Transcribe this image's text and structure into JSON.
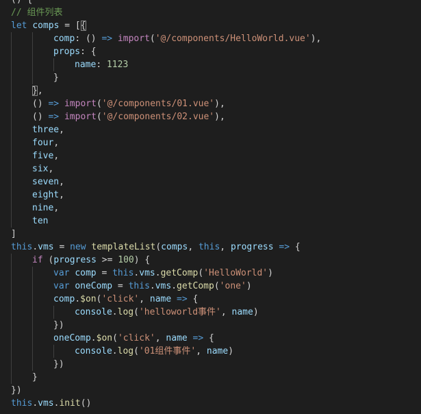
{
  "editor": {
    "lines": [
      {
        "indent": 0,
        "tokens": [
          {
            "t": "() {",
            "c": "punct"
          }
        ]
      },
      {
        "indent": 0,
        "tokens": [
          {
            "t": "// 组件列表",
            "c": "comment"
          }
        ]
      },
      {
        "indent": 0,
        "tokens": [
          {
            "t": "let",
            "c": "keyword"
          },
          {
            "t": " ",
            "c": "punct"
          },
          {
            "t": "comps",
            "c": "var"
          },
          {
            "t": " = [",
            "c": "punct"
          },
          {
            "t": "{",
            "c": "bmatch"
          }
        ]
      },
      {
        "indent": 2,
        "tokens": [
          {
            "t": "comp",
            "c": "var"
          },
          {
            "t": ": () ",
            "c": "punct"
          },
          {
            "t": "=>",
            "c": "keyword"
          },
          {
            "t": " ",
            "c": "punct"
          },
          {
            "t": "import",
            "c": "ctrl"
          },
          {
            "t": "(",
            "c": "punct"
          },
          {
            "t": "'@/components/HelloWorld.vue'",
            "c": "str"
          },
          {
            "t": "),",
            "c": "punct"
          }
        ]
      },
      {
        "indent": 2,
        "tokens": [
          {
            "t": "props",
            "c": "var"
          },
          {
            "t": ": {",
            "c": "punct"
          }
        ]
      },
      {
        "indent": 3,
        "tokens": [
          {
            "t": "name",
            "c": "var"
          },
          {
            "t": ": ",
            "c": "punct"
          },
          {
            "t": "1123",
            "c": "num"
          }
        ]
      },
      {
        "indent": 2,
        "tokens": [
          {
            "t": "}",
            "c": "punct"
          }
        ]
      },
      {
        "indent": 1,
        "tokens": [
          {
            "t": "}",
            "c": "bmatch"
          },
          {
            "t": ",",
            "c": "punct"
          }
        ]
      },
      {
        "indent": 1,
        "tokens": [
          {
            "t": "() ",
            "c": "punct"
          },
          {
            "t": "=>",
            "c": "keyword"
          },
          {
            "t": " ",
            "c": "punct"
          },
          {
            "t": "import",
            "c": "ctrl"
          },
          {
            "t": "(",
            "c": "punct"
          },
          {
            "t": "'@/components/01.vue'",
            "c": "str"
          },
          {
            "t": "),",
            "c": "punct"
          }
        ]
      },
      {
        "indent": 1,
        "tokens": [
          {
            "t": "() ",
            "c": "punct"
          },
          {
            "t": "=>",
            "c": "keyword"
          },
          {
            "t": " ",
            "c": "punct"
          },
          {
            "t": "import",
            "c": "ctrl"
          },
          {
            "t": "(",
            "c": "punct"
          },
          {
            "t": "'@/components/02.vue'",
            "c": "str"
          },
          {
            "t": "),",
            "c": "punct"
          }
        ]
      },
      {
        "indent": 1,
        "tokens": [
          {
            "t": "three",
            "c": "var"
          },
          {
            "t": ",",
            "c": "punct"
          }
        ]
      },
      {
        "indent": 1,
        "tokens": [
          {
            "t": "four",
            "c": "var"
          },
          {
            "t": ",",
            "c": "punct"
          }
        ]
      },
      {
        "indent": 1,
        "tokens": [
          {
            "t": "five",
            "c": "var"
          },
          {
            "t": ",",
            "c": "punct"
          }
        ]
      },
      {
        "indent": 1,
        "tokens": [
          {
            "t": "six",
            "c": "var"
          },
          {
            "t": ",",
            "c": "punct"
          }
        ]
      },
      {
        "indent": 1,
        "tokens": [
          {
            "t": "seven",
            "c": "var"
          },
          {
            "t": ",",
            "c": "punct"
          }
        ]
      },
      {
        "indent": 1,
        "tokens": [
          {
            "t": "eight",
            "c": "var"
          },
          {
            "t": ",",
            "c": "punct"
          }
        ]
      },
      {
        "indent": 1,
        "tokens": [
          {
            "t": "nine",
            "c": "var"
          },
          {
            "t": ",",
            "c": "punct"
          }
        ]
      },
      {
        "indent": 1,
        "tokens": [
          {
            "t": "ten",
            "c": "var"
          }
        ]
      },
      {
        "indent": 0,
        "tokens": [
          {
            "t": "]",
            "c": "punct"
          }
        ]
      },
      {
        "indent": 0,
        "tokens": [
          {
            "t": "this",
            "c": "keyword"
          },
          {
            "t": ".",
            "c": "punct"
          },
          {
            "t": "vms",
            "c": "var"
          },
          {
            "t": " = ",
            "c": "punct"
          },
          {
            "t": "new",
            "c": "keyword"
          },
          {
            "t": " ",
            "c": "punct"
          },
          {
            "t": "templateList",
            "c": "fn"
          },
          {
            "t": "(",
            "c": "punct"
          },
          {
            "t": "comps",
            "c": "var"
          },
          {
            "t": ", ",
            "c": "punct"
          },
          {
            "t": "this",
            "c": "keyword"
          },
          {
            "t": ", ",
            "c": "punct"
          },
          {
            "t": "progress",
            "c": "var"
          },
          {
            "t": " ",
            "c": "punct"
          },
          {
            "t": "=>",
            "c": "keyword"
          },
          {
            "t": " {",
            "c": "punct"
          }
        ]
      },
      {
        "indent": 1,
        "tokens": [
          {
            "t": "if",
            "c": "ctrl"
          },
          {
            "t": " (",
            "c": "punct"
          },
          {
            "t": "progress",
            "c": "var"
          },
          {
            "t": " >= ",
            "c": "punct"
          },
          {
            "t": "100",
            "c": "num"
          },
          {
            "t": ") {",
            "c": "punct"
          }
        ]
      },
      {
        "indent": 2,
        "tokens": [
          {
            "t": "var",
            "c": "keyword"
          },
          {
            "t": " ",
            "c": "punct"
          },
          {
            "t": "comp",
            "c": "var"
          },
          {
            "t": " = ",
            "c": "punct"
          },
          {
            "t": "this",
            "c": "keyword"
          },
          {
            "t": ".",
            "c": "punct"
          },
          {
            "t": "vms",
            "c": "var"
          },
          {
            "t": ".",
            "c": "punct"
          },
          {
            "t": "getComp",
            "c": "fn"
          },
          {
            "t": "(",
            "c": "punct"
          },
          {
            "t": "'HelloWorld'",
            "c": "str"
          },
          {
            "t": ")",
            "c": "punct"
          }
        ]
      },
      {
        "indent": 2,
        "tokens": [
          {
            "t": "var",
            "c": "keyword"
          },
          {
            "t": " ",
            "c": "punct"
          },
          {
            "t": "oneComp",
            "c": "var"
          },
          {
            "t": " = ",
            "c": "punct"
          },
          {
            "t": "this",
            "c": "keyword"
          },
          {
            "t": ".",
            "c": "punct"
          },
          {
            "t": "vms",
            "c": "var"
          },
          {
            "t": ".",
            "c": "punct"
          },
          {
            "t": "getComp",
            "c": "fn"
          },
          {
            "t": "(",
            "c": "punct"
          },
          {
            "t": "'one'",
            "c": "str"
          },
          {
            "t": ")",
            "c": "punct"
          }
        ]
      },
      {
        "indent": 2,
        "tokens": [
          {
            "t": "comp",
            "c": "var"
          },
          {
            "t": ".",
            "c": "punct"
          },
          {
            "t": "$on",
            "c": "fn"
          },
          {
            "t": "(",
            "c": "punct"
          },
          {
            "t": "'click'",
            "c": "str"
          },
          {
            "t": ", ",
            "c": "punct"
          },
          {
            "t": "name",
            "c": "var"
          },
          {
            "t": " ",
            "c": "punct"
          },
          {
            "t": "=>",
            "c": "keyword"
          },
          {
            "t": " {",
            "c": "punct"
          }
        ]
      },
      {
        "indent": 3,
        "tokens": [
          {
            "t": "console",
            "c": "var"
          },
          {
            "t": ".",
            "c": "punct"
          },
          {
            "t": "log",
            "c": "fn"
          },
          {
            "t": "(",
            "c": "punct"
          },
          {
            "t": "'helloworld事件'",
            "c": "str"
          },
          {
            "t": ", ",
            "c": "punct"
          },
          {
            "t": "name",
            "c": "var"
          },
          {
            "t": ")",
            "c": "punct"
          }
        ]
      },
      {
        "indent": 2,
        "tokens": [
          {
            "t": "})",
            "c": "punct"
          }
        ]
      },
      {
        "indent": 2,
        "tokens": [
          {
            "t": "oneComp",
            "c": "var"
          },
          {
            "t": ".",
            "c": "punct"
          },
          {
            "t": "$on",
            "c": "fn"
          },
          {
            "t": "(",
            "c": "punct"
          },
          {
            "t": "'click'",
            "c": "str"
          },
          {
            "t": ", ",
            "c": "punct"
          },
          {
            "t": "name",
            "c": "var"
          },
          {
            "t": " ",
            "c": "punct"
          },
          {
            "t": "=>",
            "c": "keyword"
          },
          {
            "t": " {",
            "c": "punct"
          }
        ]
      },
      {
        "indent": 3,
        "tokens": [
          {
            "t": "console",
            "c": "var"
          },
          {
            "t": ".",
            "c": "punct"
          },
          {
            "t": "log",
            "c": "fn"
          },
          {
            "t": "(",
            "c": "punct"
          },
          {
            "t": "'01组件事件'",
            "c": "str"
          },
          {
            "t": ", ",
            "c": "punct"
          },
          {
            "t": "name",
            "c": "var"
          },
          {
            "t": ")",
            "c": "punct"
          }
        ]
      },
      {
        "indent": 2,
        "tokens": [
          {
            "t": "})",
            "c": "punct"
          }
        ]
      },
      {
        "indent": 1,
        "tokens": [
          {
            "t": "}",
            "c": "punct"
          }
        ]
      },
      {
        "indent": 0,
        "tokens": [
          {
            "t": "})",
            "c": "punct"
          }
        ]
      },
      {
        "indent": 0,
        "tokens": [
          {
            "t": "this",
            "c": "keyword"
          },
          {
            "t": ".",
            "c": "punct"
          },
          {
            "t": "vms",
            "c": "var"
          },
          {
            "t": ".",
            "c": "punct"
          },
          {
            "t": "init",
            "c": "fn"
          },
          {
            "t": "()",
            "c": "punct"
          }
        ]
      }
    ]
  },
  "colors": {
    "background": "#1e1e1e",
    "comment": "#6a9955",
    "keyword": "#569cd6",
    "variable": "#9cdcfe",
    "function": "#dcdcaa",
    "string": "#ce9178",
    "number": "#b5cea8",
    "control": "#c586c0",
    "punctuation": "#d4d4d4",
    "indent_guide": "#404040"
  }
}
